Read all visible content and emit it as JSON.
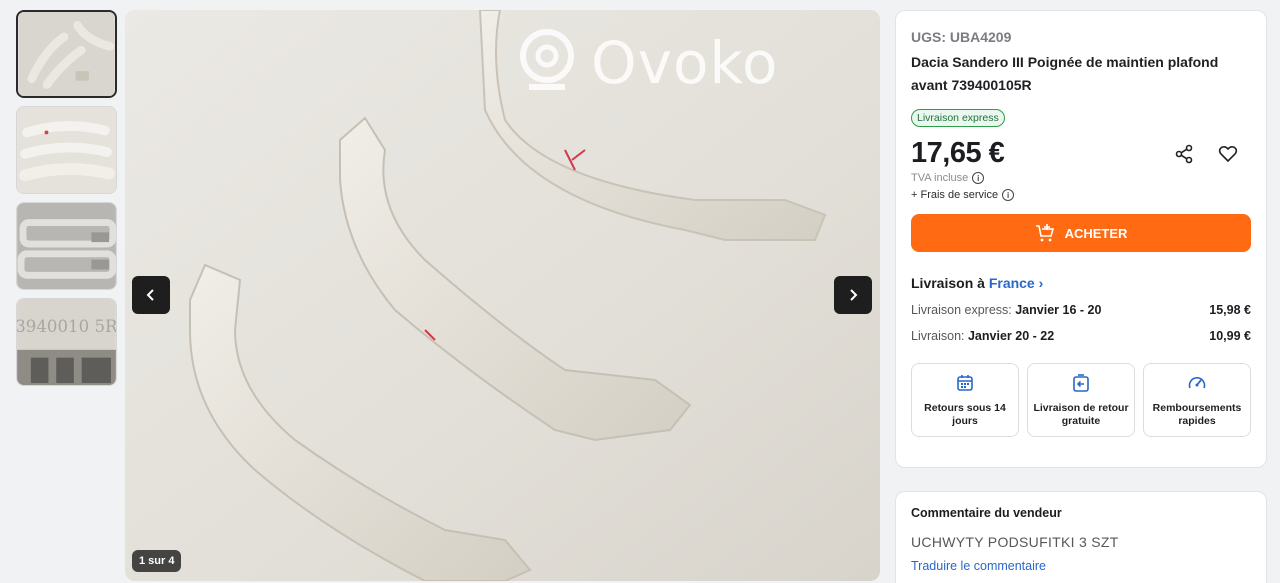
{
  "gallery": {
    "thumbnails": [
      {
        "icon": "thumbnail-handles-top-view",
        "active": true
      },
      {
        "icon": "thumbnail-handles-stacked"
      },
      {
        "icon": "thumbnail-handles-underside"
      },
      {
        "icon": "thumbnail-part-number-closeup"
      }
    ],
    "watermark": "Ovoko",
    "counter": "1 sur 4"
  },
  "product": {
    "sku": "UGS: UBA4209",
    "title": "Dacia Sandero III Poignée de maintien plafond avant 739400105R",
    "badge": "Livraison express",
    "price": "17,65 €",
    "vat": "TVA incluse",
    "fees": "+ Frais de service",
    "buy_label": "ACHETER",
    "accent_color": "#ff6a13"
  },
  "delivery": {
    "heading_prefix": "Livraison à",
    "country": "France",
    "rows": [
      {
        "label": "Livraison express:",
        "dates": "Janvier 16 - 20",
        "fee": "15,98 €"
      },
      {
        "label": "Livraison:",
        "dates": "Janvier 20 - 22",
        "fee": "10,99 €"
      }
    ]
  },
  "features": [
    {
      "icon": "calendar-icon",
      "text": "Retours sous 14 jours"
    },
    {
      "icon": "return-box-icon",
      "text": "Livraison de retour gratuite"
    },
    {
      "icon": "speedometer-icon",
      "text": "Remboursements rapides"
    }
  ],
  "comment": {
    "title": "Commentaire du vendeur",
    "text": "UCHWYTY PODSUFITKI 3 SZT",
    "translate": "Traduire le commentaire"
  }
}
